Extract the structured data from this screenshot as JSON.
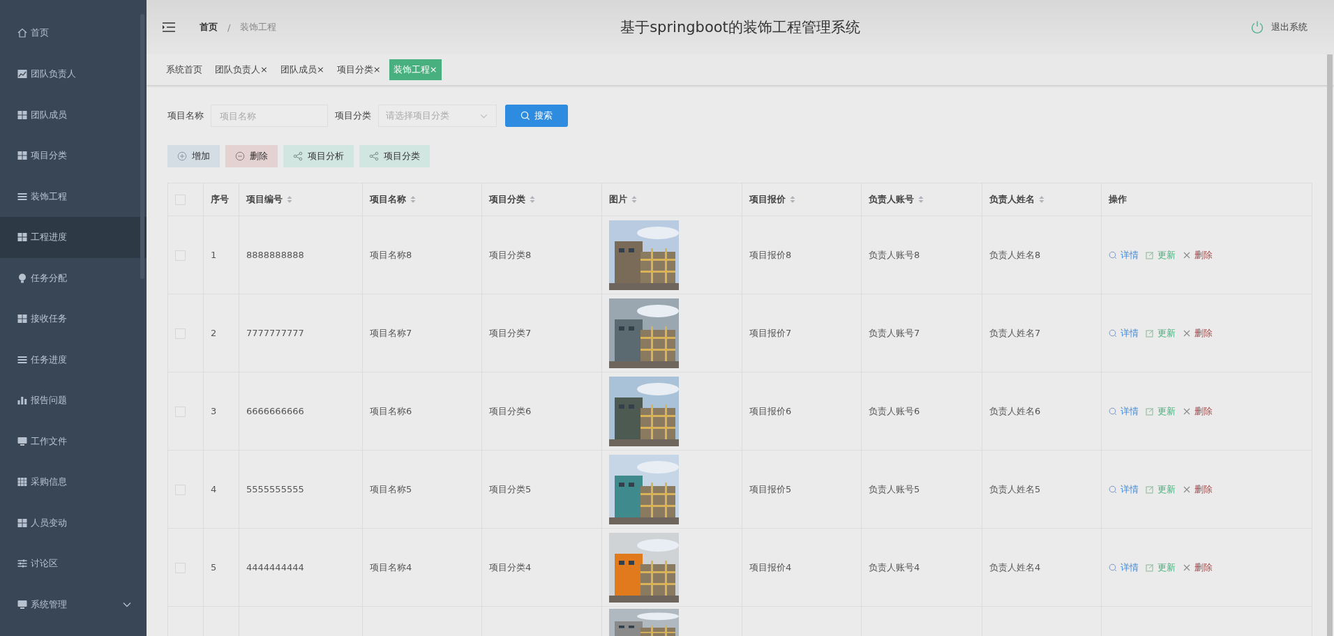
{
  "sidebar": {
    "items": [
      {
        "label": "首页",
        "kind": "home",
        "highlighted": false
      },
      {
        "label": "团队负责人",
        "kind": "chart",
        "highlighted": false
      },
      {
        "label": "团队成员",
        "kind": "grid",
        "highlighted": false
      },
      {
        "label": "项目分类",
        "kind": "grid",
        "highlighted": false
      },
      {
        "label": "装饰工程",
        "kind": "list",
        "highlighted": false
      },
      {
        "label": "工程进度",
        "kind": "grid",
        "highlighted": true
      },
      {
        "label": "任务分配",
        "kind": "bulb",
        "highlighted": false
      },
      {
        "label": "接收任务",
        "kind": "grid",
        "highlighted": false
      },
      {
        "label": "任务进度",
        "kind": "list",
        "highlighted": false
      },
      {
        "label": "报告问题",
        "kind": "bars",
        "highlighted": false
      },
      {
        "label": "工作文件",
        "kind": "monitor",
        "highlighted": false
      },
      {
        "label": "采购信息",
        "kind": "grid9",
        "highlighted": false
      },
      {
        "label": "人员变动",
        "kind": "grid",
        "highlighted": false
      },
      {
        "label": "讨论区",
        "kind": "sliders",
        "highlighted": false
      },
      {
        "label": "系统管理",
        "kind": "monitor",
        "highlighted": false,
        "expandable": true
      }
    ]
  },
  "header": {
    "breadcrumb": [
      "首页",
      "装饰工程"
    ],
    "breadcrumb_separator": "/",
    "title": "基于springboot的装饰工程管理系统",
    "logout": "退出系统"
  },
  "tabs": [
    {
      "label": "系统首页",
      "closable": false,
      "selected": false
    },
    {
      "label": "团队负责人",
      "closable": true,
      "selected": false
    },
    {
      "label": "团队成员",
      "closable": true,
      "selected": false
    },
    {
      "label": "项目分类",
      "closable": true,
      "selected": false
    },
    {
      "label": "装饰工程",
      "closable": true,
      "selected": true
    }
  ],
  "close_glyph": "×",
  "search": {
    "name_label": "项目名称",
    "name_placeholder": "项目名称",
    "category_label": "项目分类",
    "category_placeholder": "请选择项目分类",
    "button": "搜索"
  },
  "actions": [
    {
      "label": "增加",
      "kind": "add"
    },
    {
      "label": "删除",
      "kind": "delete"
    },
    {
      "label": "项目分析",
      "kind": "share"
    },
    {
      "label": "项目分类",
      "kind": "share"
    }
  ],
  "table": {
    "select_all_checked": false,
    "columns": [
      {
        "label": "序号",
        "sortable": false
      },
      {
        "label": "项目编号",
        "sortable": true
      },
      {
        "label": "项目名称",
        "sortable": true
      },
      {
        "label": "项目分类",
        "sortable": true
      },
      {
        "label": "图片",
        "sortable": true
      },
      {
        "label": "项目报价",
        "sortable": true
      },
      {
        "label": "负责人账号",
        "sortable": true
      },
      {
        "label": "负责人姓名",
        "sortable": true
      },
      {
        "label": "操作",
        "sortable": false
      }
    ],
    "rows": [
      {
        "checked": false,
        "index": "1",
        "code": "8888888888",
        "name": "项目名称8",
        "category": "项目分类8",
        "image": {
          "kind": "picture"
        },
        "price": "项目报价8",
        "account": "负责人账号8",
        "person": "负责人姓名8",
        "actions": [
          {
            "label": "详情",
            "kind": "view"
          },
          {
            "label": "更新",
            "kind": "edit"
          },
          {
            "label": "删除",
            "kind": "delete"
          }
        ]
      },
      {
        "checked": false,
        "index": "2",
        "code": "7777777777",
        "name": "项目名称7",
        "category": "项目分类7",
        "image": {
          "kind": "picture"
        },
        "price": "项目报价7",
        "account": "负责人账号7",
        "person": "负责人姓名7",
        "actions": [
          {
            "label": "详情",
            "kind": "view"
          },
          {
            "label": "更新",
            "kind": "edit"
          },
          {
            "label": "删除",
            "kind": "delete"
          }
        ]
      },
      {
        "checked": false,
        "index": "3",
        "code": "6666666666",
        "name": "项目名称6",
        "category": "项目分类6",
        "image": {
          "kind": "picture"
        },
        "price": "项目报价6",
        "account": "负责人账号6",
        "person": "负责人姓名6",
        "actions": [
          {
            "label": "详情",
            "kind": "view"
          },
          {
            "label": "更新",
            "kind": "edit"
          },
          {
            "label": "删除",
            "kind": "delete"
          }
        ]
      },
      {
        "checked": false,
        "index": "4",
        "code": "5555555555",
        "name": "项目名称5",
        "category": "项目分类5",
        "image": {
          "kind": "picture"
        },
        "price": "项目报价5",
        "account": "负责人账号5",
        "person": "负责人姓名5",
        "actions": [
          {
            "label": "详情",
            "kind": "view"
          },
          {
            "label": "更新",
            "kind": "edit"
          },
          {
            "label": "删除",
            "kind": "delete"
          }
        ]
      },
      {
        "checked": false,
        "index": "5",
        "code": "4444444444",
        "name": "项目名称4",
        "category": "项目分类4",
        "image": {
          "kind": "picture"
        },
        "price": "项目报价4",
        "account": "负责人账号4",
        "person": "负责人姓名4",
        "actions": [
          {
            "label": "详情",
            "kind": "view"
          },
          {
            "label": "更新",
            "kind": "edit"
          },
          {
            "label": "删除",
            "kind": "delete"
          }
        ]
      },
      {
        "image": {
          "kind": "picture"
        }
      }
    ]
  }
}
